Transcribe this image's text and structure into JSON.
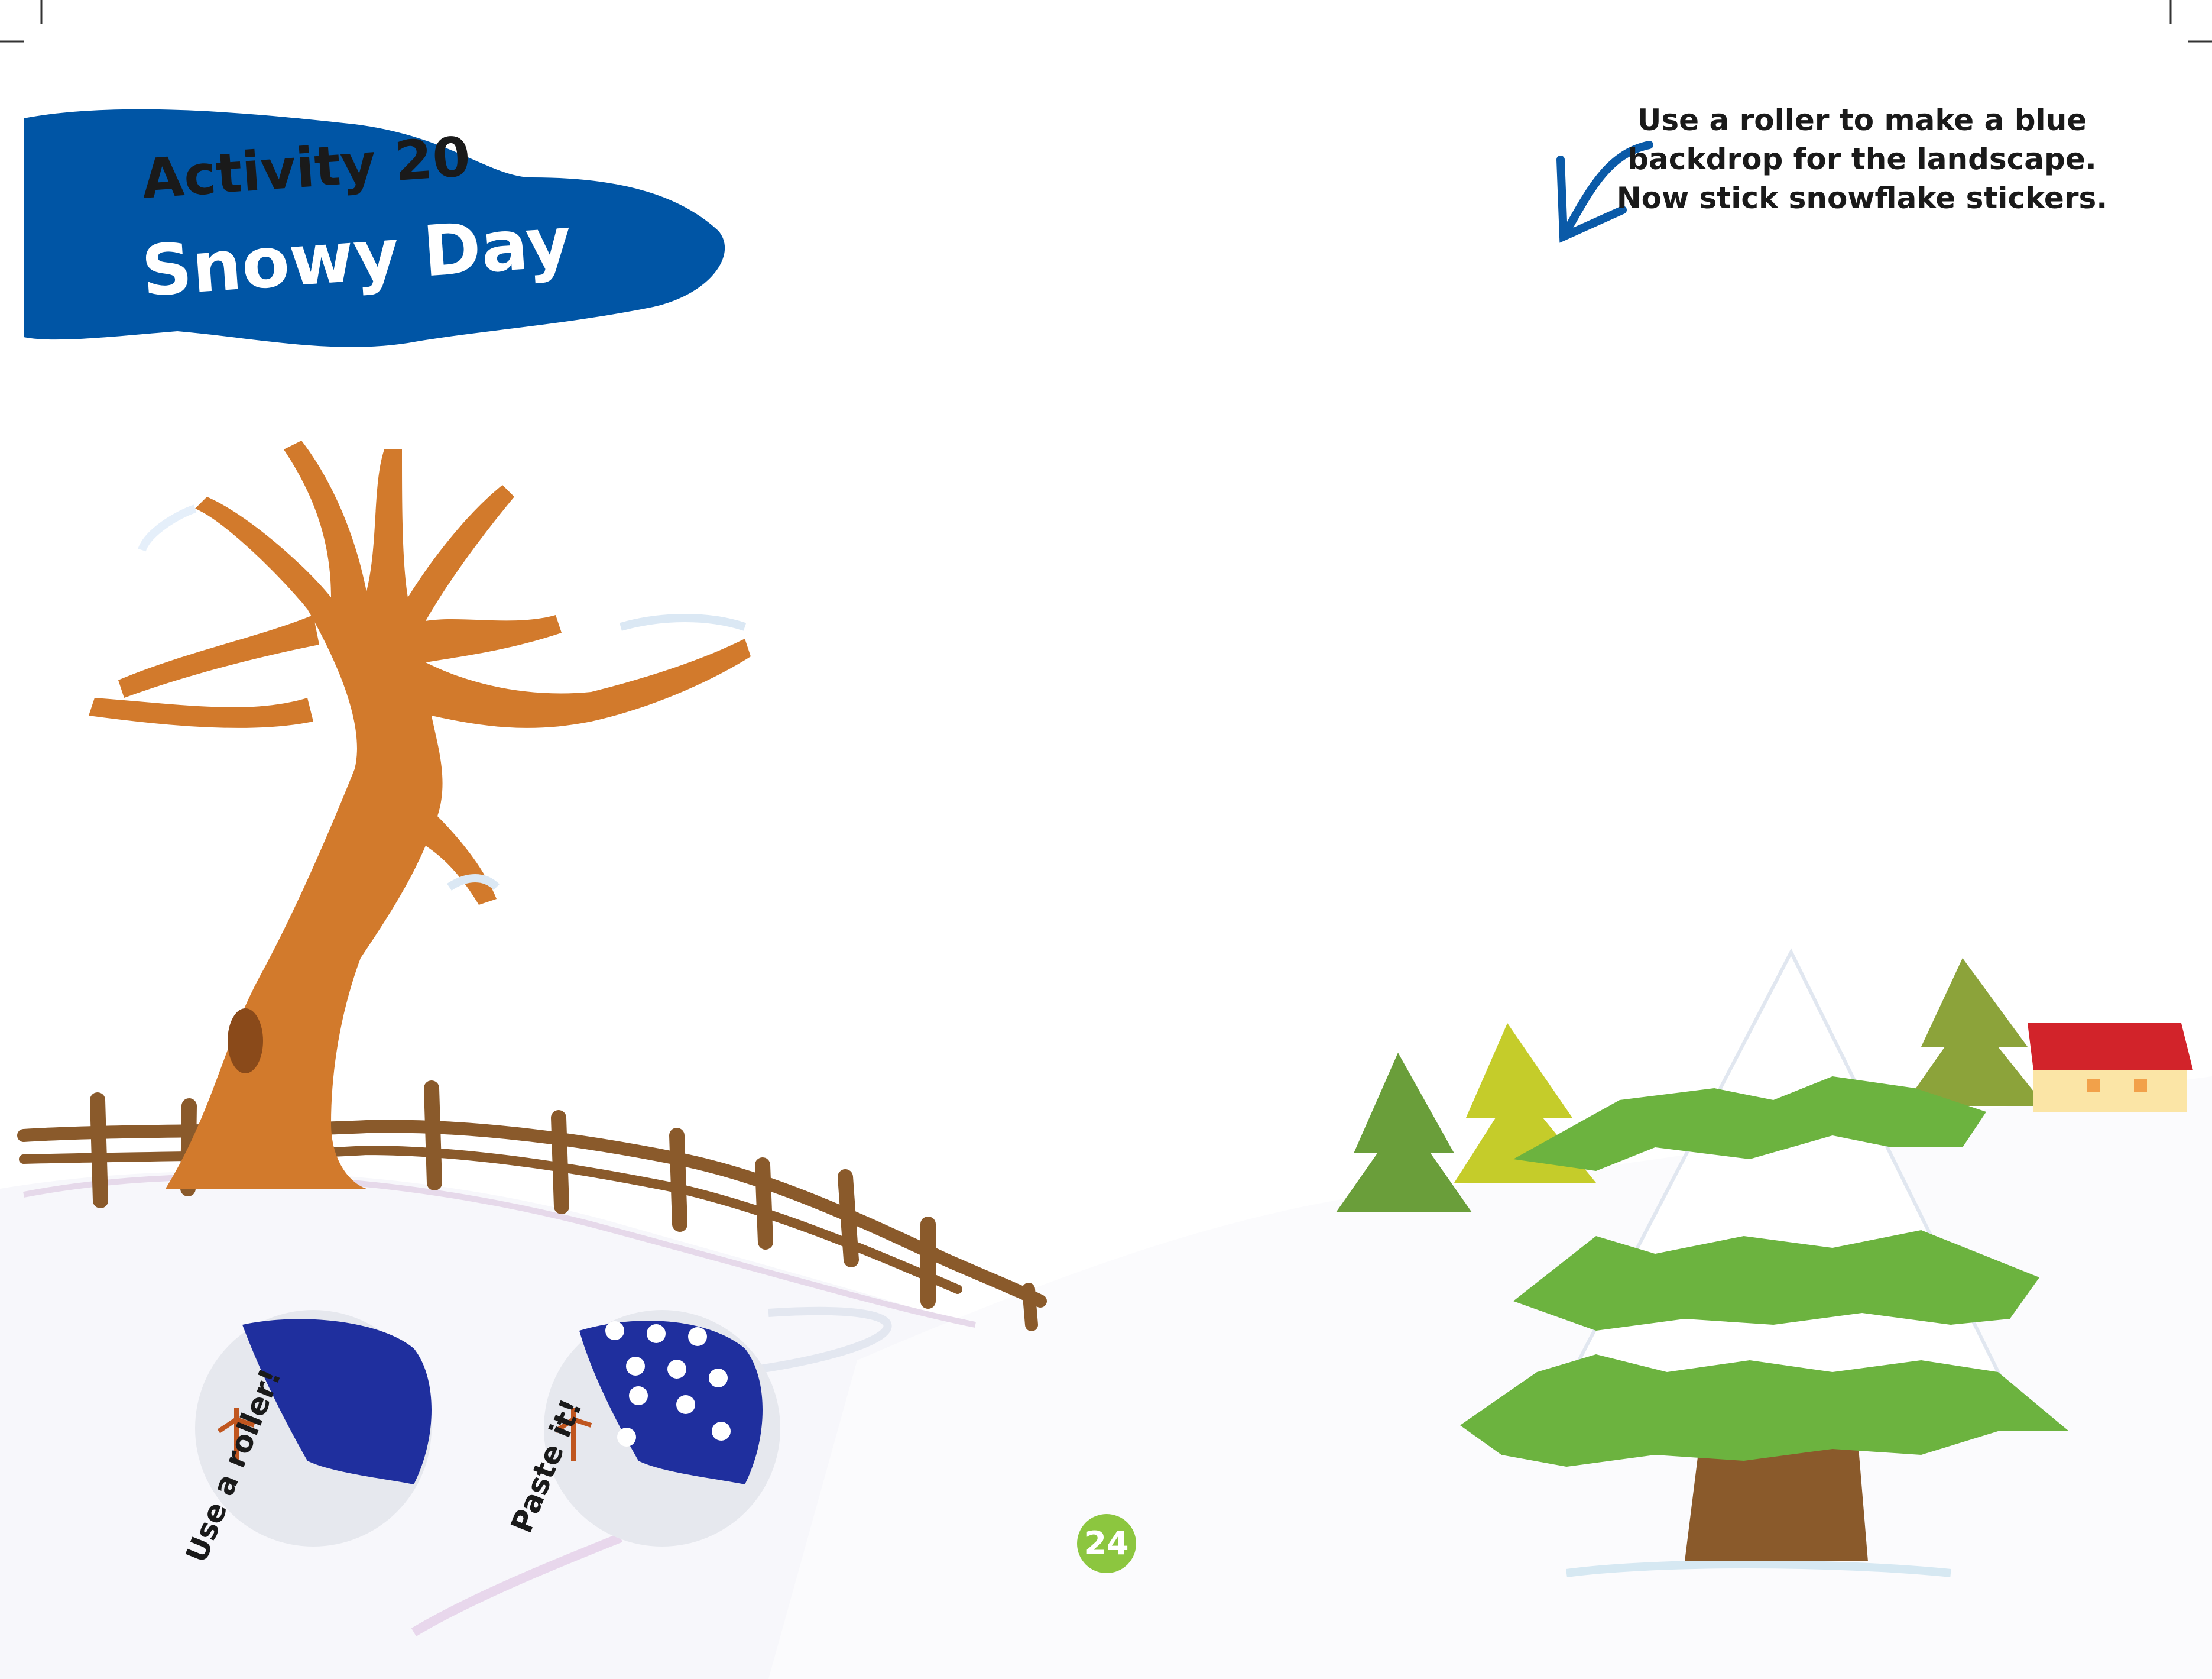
{
  "header": {
    "activity_label": "Activity 20",
    "title": "Snowy Day"
  },
  "instruction": {
    "lines": [
      "Use a roller to make a blue",
      "backdrop for the landscape.",
      "Now stick snowflake stickers."
    ]
  },
  "steps": [
    {
      "caption": "Use a roller!",
      "icon": "paint-roller-example"
    },
    {
      "caption": "Paste it!",
      "icon": "snowflake-sticker-example"
    }
  ],
  "footer": {
    "page_number": "24"
  },
  "colors": {
    "banner_blue": "#0055a5",
    "arrow_blue": "#0a5aa8",
    "tree_trunk": "#c9772a",
    "pine_green": "#6cb33f",
    "page_badge_green": "#8cc63f",
    "roof_red": "#d2232a"
  }
}
